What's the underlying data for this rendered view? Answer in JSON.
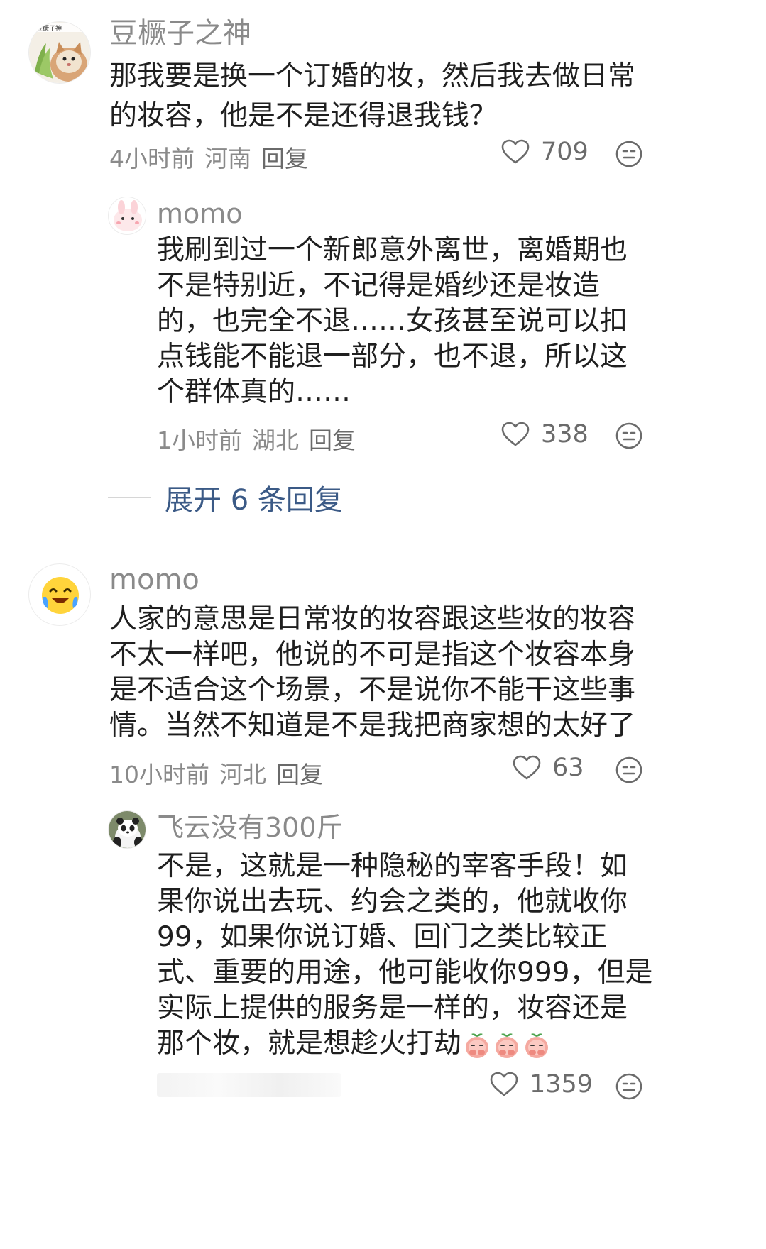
{
  "comments": [
    {
      "username": "豆橛子之神",
      "avatar": "cat-avatar",
      "avatar_caption": "豆橛子神",
      "text": "那我要是换一个订婚的妆，然后我去做日常的妆容，他是不是还得退我钱？",
      "time": "4小时前",
      "location": "河南",
      "reply_label": "回复",
      "likes": "709",
      "replies": [
        {
          "username": "momo",
          "avatar": "pink-rabbit-avatar",
          "text": "我刷到过一个新郎意外离世，离婚期也不是特别近，不记得是婚纱还是妆造的，也完全不退……女孩甚至说可以扣点钱能不能退一部分，也不退，所以这个群体真的……",
          "time": "1小时前",
          "location": "湖北",
          "reply_label": "回复",
          "likes": "338"
        }
      ],
      "expand_label": "展开 6 条回复"
    },
    {
      "username": "momo",
      "avatar": "laughing-emoji-avatar",
      "text": "人家的意思是日常妆的妆容跟这些妆的妆容不太一样吧，他说的不可是指这个妆容本身是不适合这个场景，不是说你不能干这些事情。当然不知道是不是我把商家想的太好了",
      "time": "10小时前",
      "location": "河北",
      "reply_label": "回复",
      "likes": "63",
      "replies": [
        {
          "username": "飞云没有300斤",
          "avatar": "panda-avatar",
          "text": "不是，这就是一种隐秘的宰客手段！如果你说出去玩、约会之类的，他就收你99，如果你说订婚、回门之类比较正式、重要的用途，他可能收你999，但是实际上提供的服务是一样的，妆容还是那个妆，就是想趁火打劫",
          "trailing_emojis": [
            "peach-cover-mouth-emoji",
            "peach-cover-mouth-emoji",
            "peach-cover-mouth-emoji"
          ],
          "likes": "1359"
        }
      ]
    }
  ],
  "colors": {
    "username": "#8a8a8a",
    "text": "#1f1f1f",
    "meta": "#8a8a8a",
    "expand_link": "#3b5a86"
  }
}
